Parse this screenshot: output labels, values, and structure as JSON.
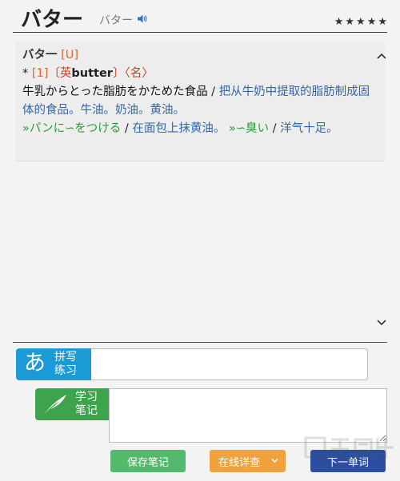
{
  "header": {
    "word": "バター",
    "reading": "バター",
    "stars": [
      "★",
      "★",
      "★",
      "★",
      "★"
    ]
  },
  "entry": {
    "headword": "バタ一",
    "tag": "[U]",
    "bullet": "*",
    "sense_num": "[1]",
    "origin_open": "〔英",
    "origin_en": "butter",
    "origin_close": "〕",
    "pos": "〈名〉",
    "jp_def": "牛乳からとった脂肪をかためた食品",
    "sep1": " / ",
    "cn_def": "把从牛奶中提取的脂肪制成固体的食品。牛油。奶油。黄油。",
    "ex1_jp": "»パンに∽をつける",
    "sep2": " / ",
    "ex1_cn": "在面包上抹黄油。",
    "ex2_jp": "»∽臭い",
    "sep3": " / ",
    "ex2_cn": "洋气十足。"
  },
  "spelling": {
    "glyph": "あ",
    "label_line1": "拼写",
    "label_line2": "练习",
    "value": ""
  },
  "notes": {
    "label_line1": "学习",
    "label_line2": "笔记",
    "value": ""
  },
  "buttons": {
    "save": "保存笔记",
    "online": "在线详查",
    "next": "下一单词"
  },
  "colors": {
    "spell_badge": "#1c9ad6",
    "notes_badge": "#3fa34d",
    "save": "#52b96d",
    "online": "#f0a23e",
    "next": "#2c4ea0"
  }
}
